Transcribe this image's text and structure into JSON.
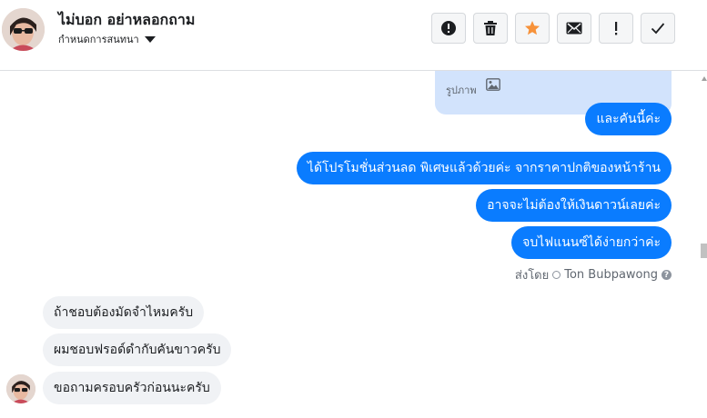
{
  "header": {
    "contact_name": "ไม่บอก อย่าหลอกถาม",
    "conversation_settings_label": "กำหนดการสนทนา",
    "actions": [
      {
        "name": "report-button",
        "icon": "exclamation-circle-icon"
      },
      {
        "name": "delete-button",
        "icon": "trash-icon"
      },
      {
        "name": "star-button",
        "icon": "star-icon"
      },
      {
        "name": "mark-unread-button",
        "icon": "envelope-icon"
      },
      {
        "name": "spam-button",
        "icon": "exclamation-icon"
      },
      {
        "name": "done-button",
        "icon": "check-icon"
      }
    ]
  },
  "thread": {
    "attachment": {
      "label": "รูปภาพ",
      "icon": "image-icon"
    },
    "outgoing": [
      "และคันนี้ค่ะ",
      "ได้โปรโมชั่นส่วนลด พิเศษแล้วด้วยค่ะ จากราคาปกติของหน้าร้าน",
      "อาจจะไม่ต้องให้เงินดาวน์เลยค่ะ",
      "จบไฟแนนซ์ได้ง่ายกว่าค่ะ"
    ],
    "sent_by_label": "ส่งโดย",
    "sent_by_name": "Ton Bubpawong",
    "incoming": [
      "ถ้าชอบต้องมัดจำไหมครับ",
      "ผมชอบฟรอด์ดำกับคันขาวครับ",
      "ขอถามครอบครัวก่อนนะครับ"
    ]
  },
  "colors": {
    "outgoing_bubble": "#0a7cff",
    "incoming_bubble": "#f0f2f5",
    "attachment_bg": "#d2e3fc",
    "star": "#f7923a"
  }
}
